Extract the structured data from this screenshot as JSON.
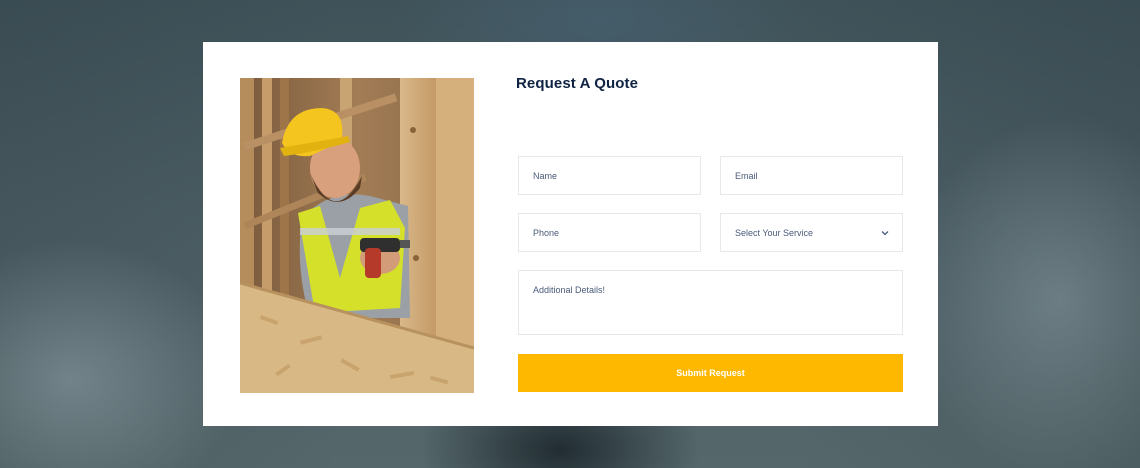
{
  "form": {
    "title": "Request A Quote",
    "name_placeholder": "Name",
    "email_placeholder": "Email",
    "phone_placeholder": "Phone",
    "service_selected": "Select Your Service",
    "details_placeholder": "Additional Details!",
    "submit_label": "Submit Request"
  },
  "colors": {
    "accent": "#ffb800",
    "title": "#0f2342",
    "field_text": "#4a5a7a",
    "field_border": "#e6e8ec"
  },
  "icons": {
    "select_arrow": "chevron-down-icon"
  }
}
